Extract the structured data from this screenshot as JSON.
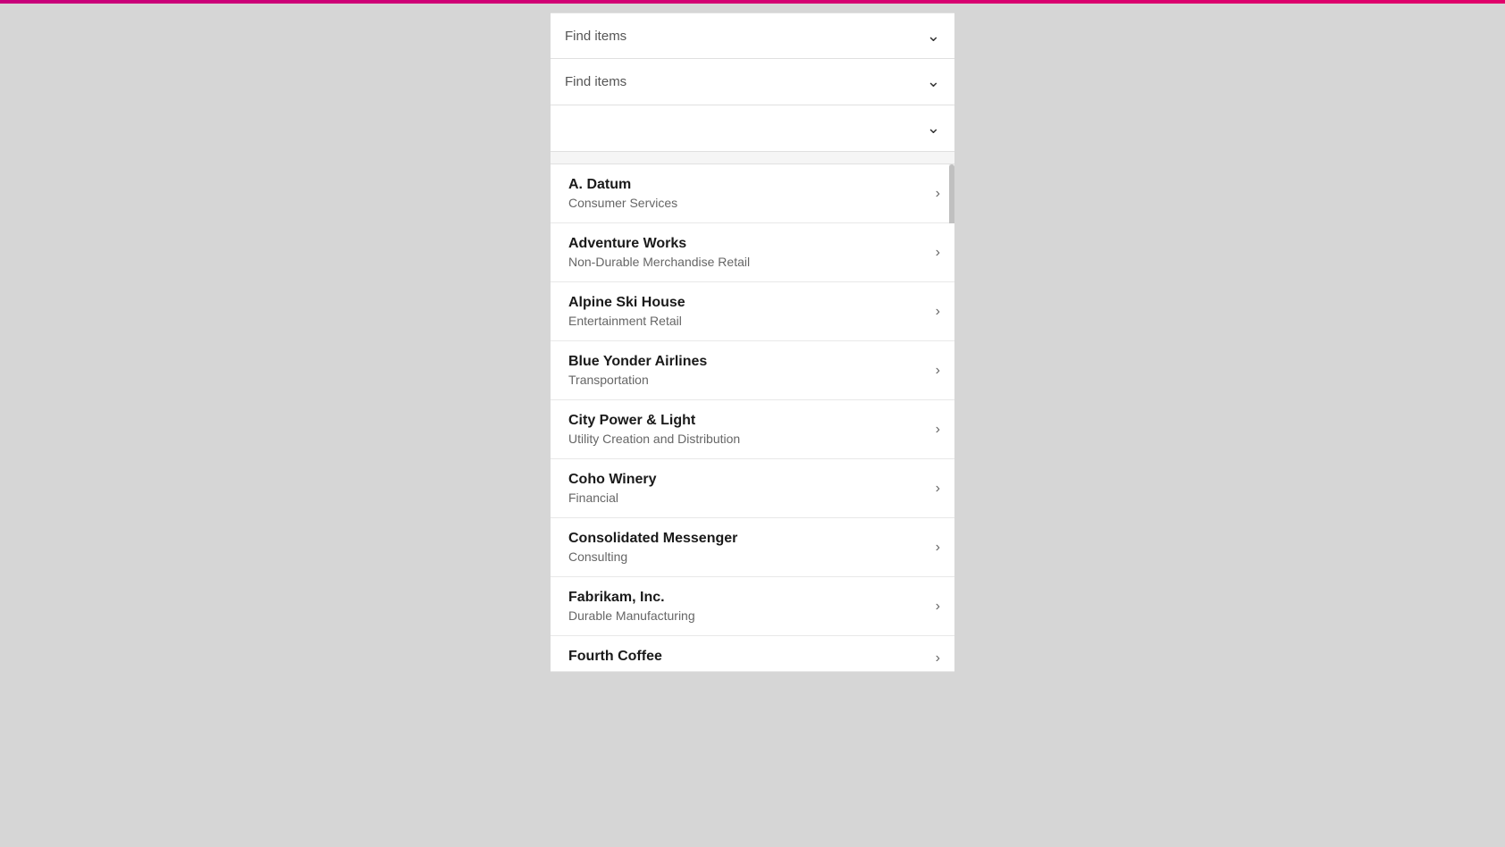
{
  "dropdowns": [
    {
      "id": "dropdown-1",
      "placeholder": "Find items",
      "hasValue": false
    },
    {
      "id": "dropdown-2",
      "placeholder": "Find items",
      "hasValue": false
    },
    {
      "id": "dropdown-3",
      "placeholder": "",
      "hasValue": false
    }
  ],
  "list_items": [
    {
      "id": "item-a-datum",
      "title": "A. Datum",
      "subtitle": "Consumer Services"
    },
    {
      "id": "item-adventure-works",
      "title": "Adventure Works",
      "subtitle": "Non-Durable Merchandise Retail"
    },
    {
      "id": "item-alpine-ski-house",
      "title": "Alpine Ski House",
      "subtitle": "Entertainment Retail"
    },
    {
      "id": "item-blue-yonder-airlines",
      "title": "Blue Yonder Airlines",
      "subtitle": "Transportation"
    },
    {
      "id": "item-city-power-light",
      "title": "City Power & Light",
      "subtitle": "Utility Creation and Distribution"
    },
    {
      "id": "item-coho-winery",
      "title": "Coho Winery",
      "subtitle": "Financial"
    },
    {
      "id": "item-consolidated-messenger",
      "title": "Consolidated Messenger",
      "subtitle": "Consulting"
    },
    {
      "id": "item-fabrikam",
      "title": "Fabrikam, Inc.",
      "subtitle": "Durable Manufacturing"
    },
    {
      "id": "item-fourth-coffee",
      "title": "Fourth Coffee",
      "subtitle": ""
    }
  ],
  "chevron_char": "›",
  "down_chevron_char": "⌄"
}
